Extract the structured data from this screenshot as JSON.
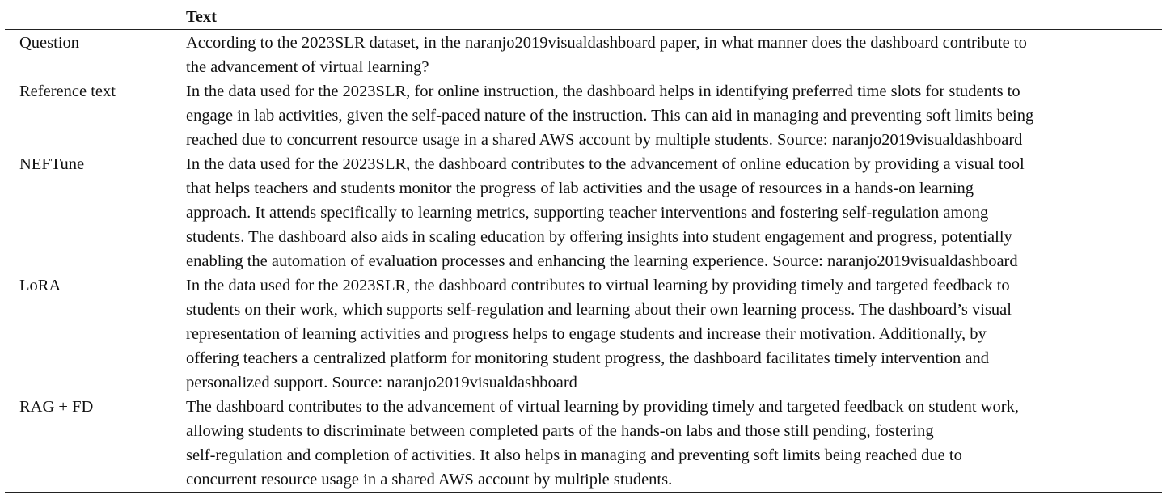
{
  "table": {
    "header": "Text",
    "rows": [
      {
        "label": "Question",
        "lines": [
          "According to the 2023SLR dataset, in the naranjo2019visualdashboard paper, in what manner does the dashboard contribute to",
          "the advancement of virtual learning?"
        ]
      },
      {
        "label": "Reference text",
        "lines": [
          "In the data used for the 2023SLR, for online instruction, the dashboard helps in identifying preferred time slots for students to",
          "engage in lab activities, given the self-paced nature of the instruction. This can aid in managing and preventing soft limits being",
          "reached due to concurrent resource usage in a shared AWS account by multiple students. Source: naranjo2019visualdashboard"
        ]
      },
      {
        "label": "NEFTune",
        "lines": [
          "In the data used for the 2023SLR, the dashboard contributes to the advancement of online education by providing a visual tool",
          "that helps teachers and students monitor the progress of lab activities and the usage of resources in a hands-on learning",
          "approach. It attends specifically to learning metrics, supporting teacher interventions and fostering self-regulation among",
          "students. The dashboard also aids in scaling education by offering insights into student engagement and progress, potentially",
          "enabling the automation of evaluation processes and enhancing the learning experience. Source: naranjo2019visualdashboard"
        ]
      },
      {
        "label": "LoRA",
        "lines": [
          "In the data used for the 2023SLR, the dashboard contributes to virtual learning by providing timely and targeted feedback to",
          "students on their work, which supports self-regulation and learning about their own learning process. The dashboard’s visual",
          "representation of learning activities and progress helps to engage students and increase their motivation. Additionally, by",
          "offering teachers a centralized platform for monitoring student progress, the dashboard facilitates timely intervention and",
          "personalized support. Source: naranjo2019visualdashboard"
        ]
      },
      {
        "label": "RAG + FD",
        "lines": [
          "The dashboard contributes to the advancement of virtual learning by providing timely and targeted feedback on student work,",
          "allowing students to discriminate between completed parts of the hands-on labs and those still pending, fostering",
          "self-regulation and completion of activities. It also helps in managing and preventing soft limits being reached due to",
          "concurrent resource usage in a shared AWS account by multiple students."
        ]
      }
    ]
  }
}
